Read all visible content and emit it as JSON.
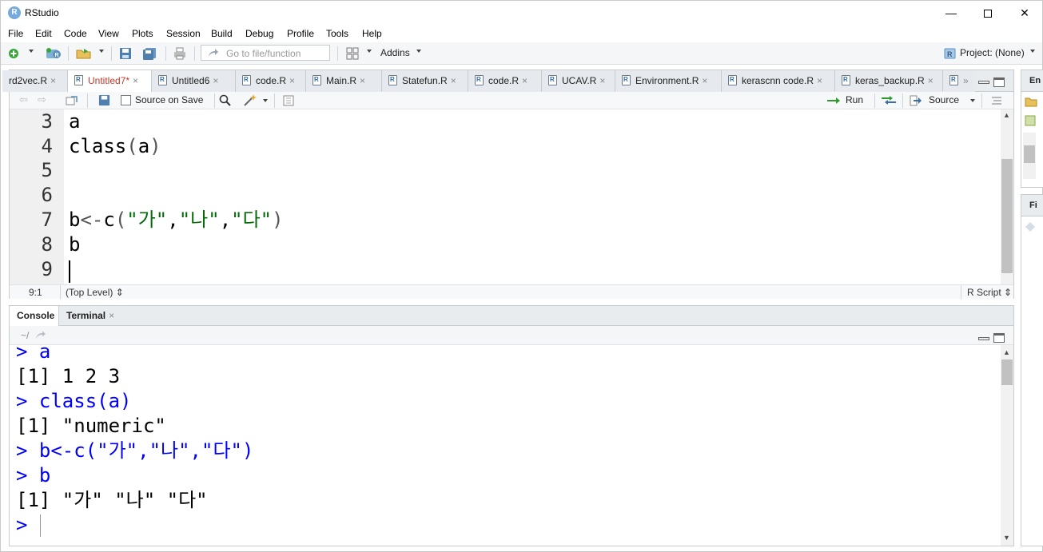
{
  "window": {
    "title": "RStudio",
    "app_icon": "R",
    "minimize": "—",
    "close": "✕"
  },
  "menu": [
    "File",
    "Edit",
    "Code",
    "View",
    "Plots",
    "Session",
    "Build",
    "Debug",
    "Profile",
    "Tools",
    "Help"
  ],
  "toolbar": {
    "goto_placeholder": "Go to file/function",
    "addins": "Addins",
    "project": "Project: (None)"
  },
  "source_tabs": [
    {
      "label": "rd2vec.R",
      "active": false
    },
    {
      "label": "Untitled7*",
      "active": true
    },
    {
      "label": "Untitled6",
      "active": false
    },
    {
      "label": "code.R",
      "active": false
    },
    {
      "label": "Main.R",
      "active": false
    },
    {
      "label": "Statefun.R",
      "active": false
    },
    {
      "label": "code.R",
      "active": false
    },
    {
      "label": "UCAV.R",
      "active": false
    },
    {
      "label": "Environment.R",
      "active": false
    },
    {
      "label": "kerascnn code.R",
      "active": false
    },
    {
      "label": "keras_backup.R",
      "active": false
    }
  ],
  "editor_toolbar": {
    "source_on_save": "Source on Save",
    "run": "Run",
    "source": "Source"
  },
  "editor": {
    "lines": [
      {
        "num": "3",
        "code": "a"
      },
      {
        "num": "4",
        "code": "class(a)"
      },
      {
        "num": "5",
        "code": ""
      },
      {
        "num": "6",
        "code": ""
      },
      {
        "num": "7",
        "code": "b<-c(\"가\",\"나\",\"다\")"
      },
      {
        "num": "8",
        "code": "b"
      },
      {
        "num": "9",
        "code": ""
      }
    ]
  },
  "status": {
    "position": "9:1",
    "scope": "(Top Level) ⇕",
    "file_type": "R Script ⇕"
  },
  "console_tabs": [
    {
      "label": "Console",
      "active": true
    },
    {
      "label": "Terminal",
      "active": false
    }
  ],
  "console_path": "~/",
  "console": [
    {
      "text": "> a",
      "kind": "input"
    },
    {
      "text": "[1] 1 2 3",
      "kind": "output"
    },
    {
      "text": "> class(a)",
      "kind": "input"
    },
    {
      "text": "[1] \"numeric\"",
      "kind": "output"
    },
    {
      "text": "> b<-c(\"가\",\"나\",\"다\")",
      "kind": "input"
    },
    {
      "text": "> b",
      "kind": "input"
    },
    {
      "text": "[1] \"가\" \"나\" \"다\"",
      "kind": "output"
    },
    {
      "text": "> ",
      "kind": "input"
    }
  ],
  "right_panes": {
    "top_label": "En",
    "bottom_label": "Fi"
  }
}
